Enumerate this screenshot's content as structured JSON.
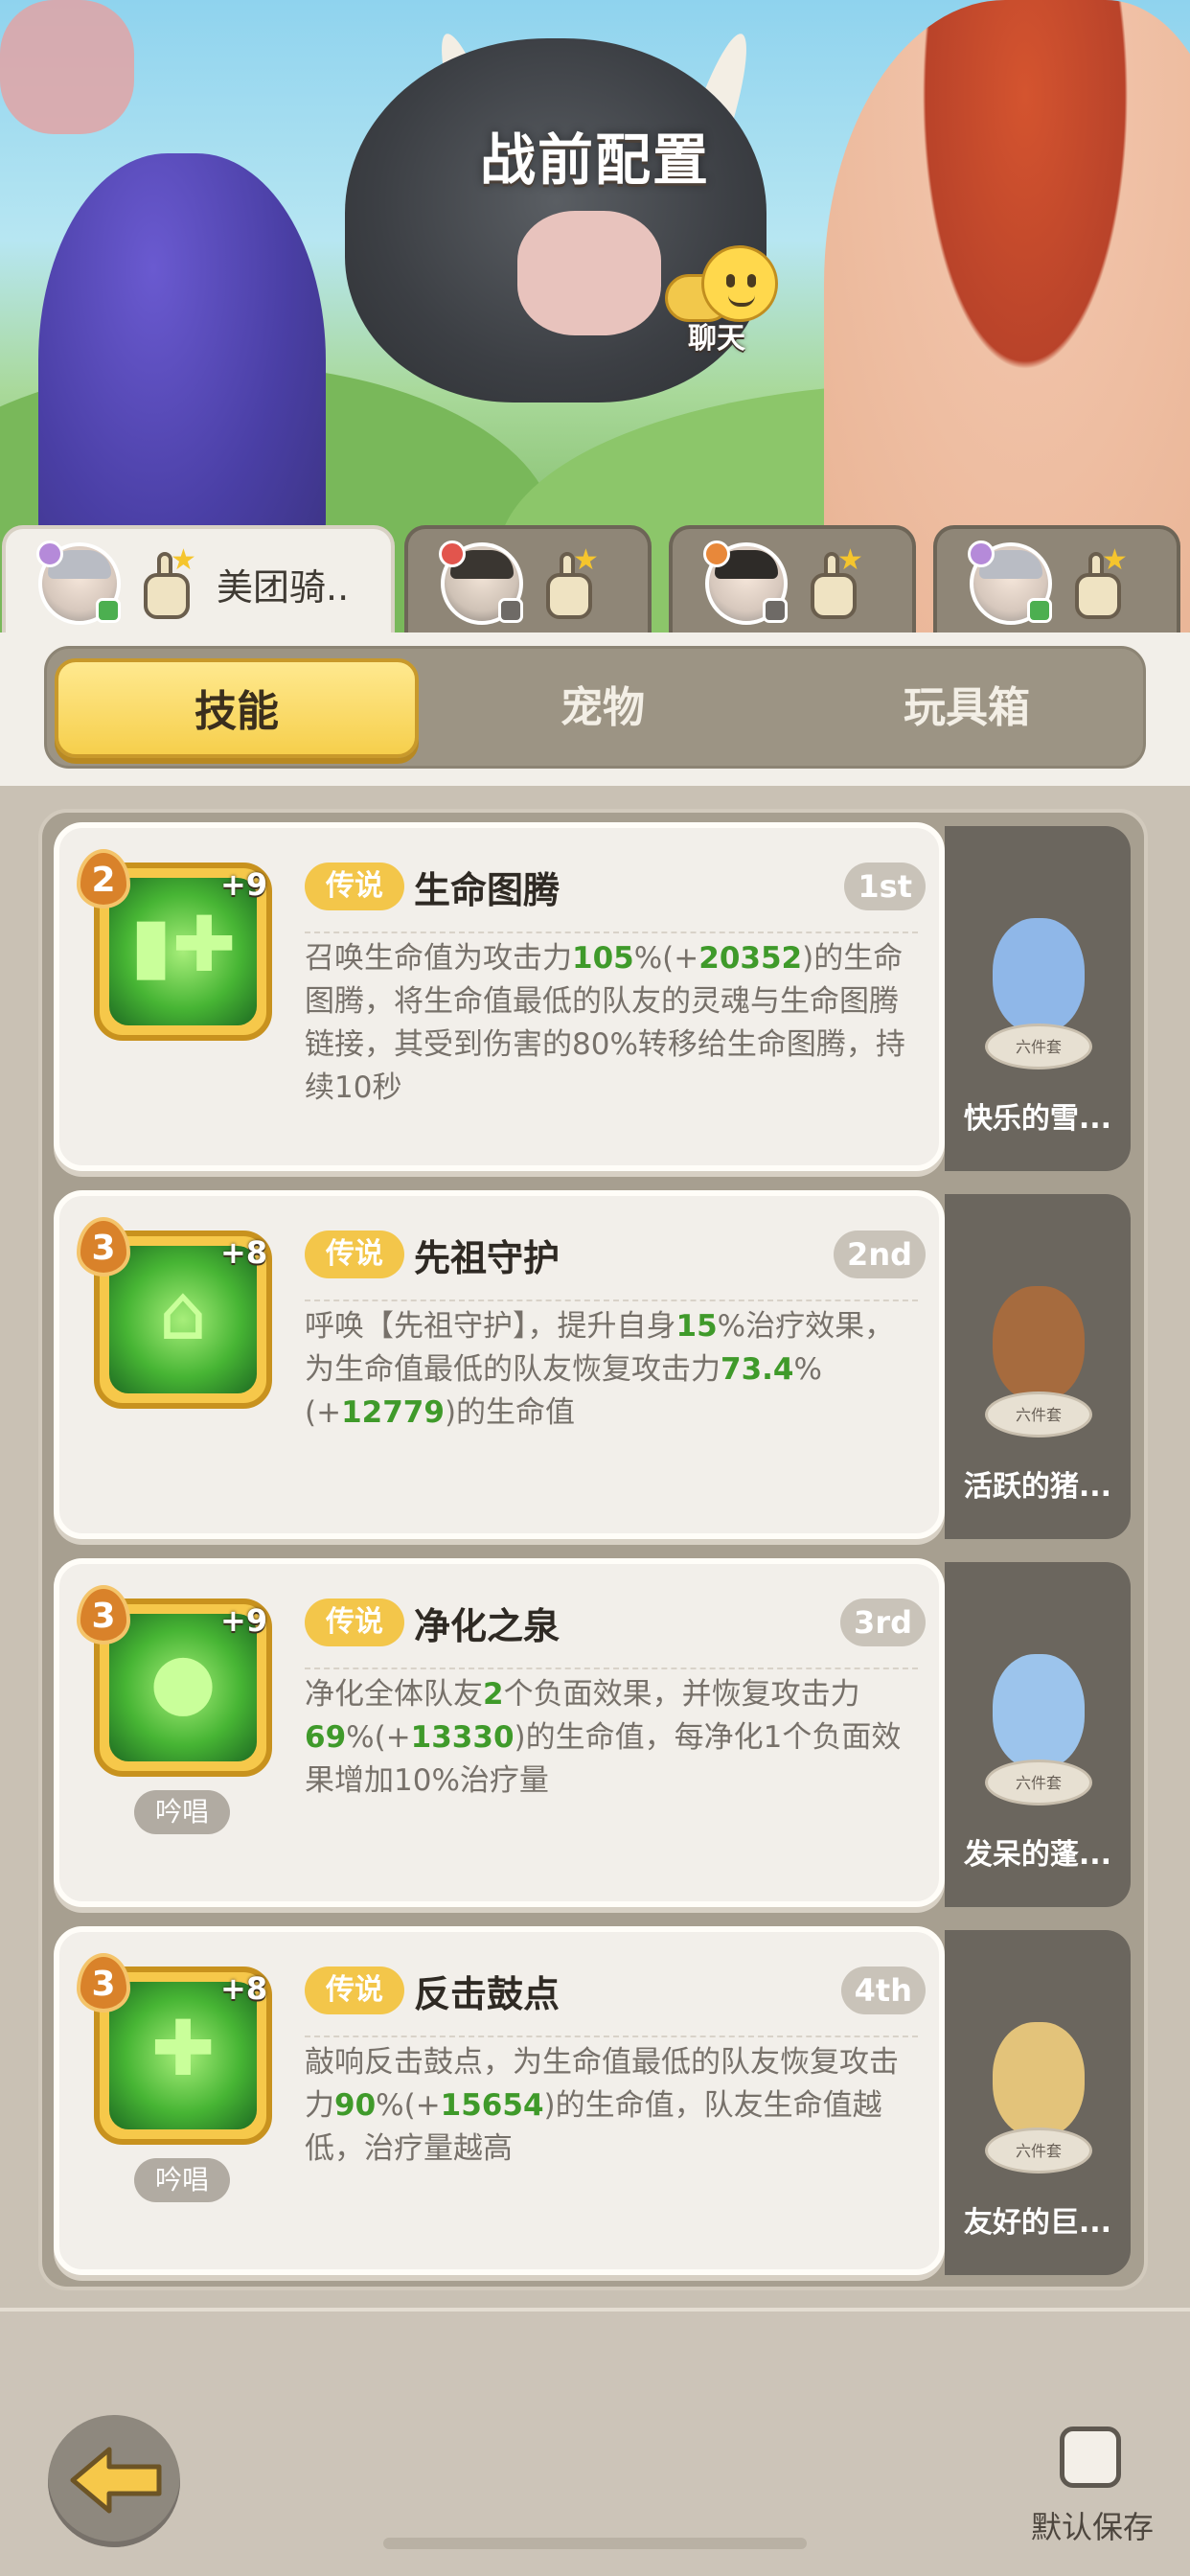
{
  "header": {
    "title": "战前配置",
    "chat_label": "聊天"
  },
  "players": [
    {
      "name": "美团骑..",
      "active": true
    },
    {
      "name": "",
      "active": false
    },
    {
      "name": "",
      "active": false
    },
    {
      "name": "",
      "active": false
    }
  ],
  "tabs": [
    {
      "label": "技能",
      "active": true
    },
    {
      "label": "宠物",
      "active": false
    },
    {
      "label": "玩具箱",
      "active": false
    }
  ],
  "skills": [
    {
      "level": "2",
      "plus": "+9",
      "rarity": "传说",
      "name": "生命图腾",
      "rank": "1st",
      "chant": "",
      "desc_parts": [
        "召唤生命值为攻击力",
        "105",
        "%(+",
        "20352",
        ")的生命图腾，将生命值最低的队友的灵魂与生命图腾链接，其受到伤害的80%转移给生命图腾，持续10秒"
      ],
      "set_tag": "六件套",
      "set_name": "快乐的雪...",
      "icon": "totem-icon"
    },
    {
      "level": "3",
      "plus": "+8",
      "rarity": "传说",
      "name": "先祖守护",
      "rank": "2nd",
      "chant": "",
      "desc_parts": [
        "呼唤【先祖守护】，提升自身",
        "15",
        "%治疗效果，为生命值最低的队友恢复攻击力",
        "73.4",
        "%(+",
        "12779",
        ")的生命值"
      ],
      "set_tag": "六件套",
      "set_name": "活跃的猪...",
      "icon": "ancestor-guard-icon"
    },
    {
      "level": "3",
      "plus": "+9",
      "rarity": "传说",
      "name": "净化之泉",
      "rank": "3rd",
      "chant": "吟唱",
      "desc_parts": [
        "净化全体队友",
        "2",
        "个负面效果，并恢复攻击力",
        "69",
        "%(+",
        "13330",
        ")的生命值，每净化1个负面效果增加10%治疗量"
      ],
      "set_tag": "六件套",
      "set_name": "发呆的蓬...",
      "icon": "purify-spring-icon"
    },
    {
      "level": "3",
      "plus": "+8",
      "rarity": "传说",
      "name": "反击鼓点",
      "rank": "4th",
      "chant": "吟唱",
      "desc_parts": [
        "敲响反击鼓点，为生命值最低的队友恢复攻击力",
        "90",
        "%(+",
        "15654",
        ")的生命值，队友生命值越低，治疗量越高"
      ],
      "set_tag": "六件套",
      "set_name": "友好的巨...",
      "icon": "drum-icon"
    }
  ],
  "footer": {
    "save_label": "默认保存"
  },
  "colors": {
    "accent_yellow": "#f6cf4c",
    "value_green": "#3f9a2a",
    "panel_grey": "#a79f90"
  }
}
